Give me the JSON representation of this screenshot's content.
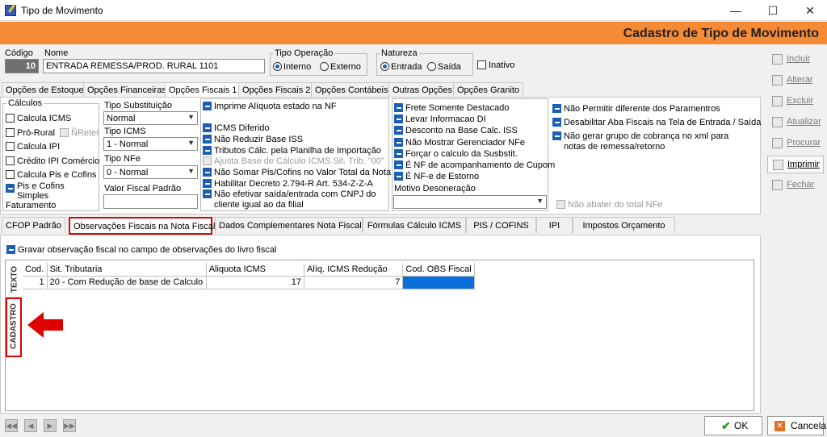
{
  "window": {
    "title": "Tipo de Movimento",
    "minimize": "—",
    "maximize": "☐",
    "close": "✕"
  },
  "header": {
    "title": "Cadastro de Tipo de Movimento"
  },
  "form": {
    "codigo_label": "Código",
    "codigo_value": "10",
    "nome_label": "Nome",
    "nome_value": "ENTRADA REMESSA/PROD. RURAL 1101",
    "tipo_operacao": {
      "label": "Tipo Operação",
      "opt1": "Interno",
      "opt2": "Externo"
    },
    "natureza": {
      "label": "Natureza",
      "opt1": "Entrada",
      "opt2": "Saída"
    },
    "inativo": "Inativo"
  },
  "top_tabs": [
    "Opções de Estoque",
    "Opções Financeiras",
    "Opções Fiscais 1",
    "Opções Fiscais 2",
    "Opções Contábeis",
    "Outras Opções",
    "Opções Granito"
  ],
  "calculos": {
    "title": "Cálculos",
    "items": [
      "Calcula ICMS",
      "Pró-Rural",
      "Calcula IPI",
      "Crédito IPI Comércio",
      "Calcula Pis e Cofins",
      "Pis e Cofins Simples Faturamento"
    ],
    "nreter": "ÑReter"
  },
  "selects": {
    "tipo_subst_label": "Tipo Substituição",
    "tipo_subst_value": "Normal",
    "tipo_icms_label": "Tipo ICMS",
    "tipo_icms_value": "1 - Normal",
    "tipo_nfe_label": "Tipo NFe",
    "tipo_nfe_value": "0 - Normal",
    "valor_fiscal_label": "Valor Fiscal Padrão"
  },
  "col2": [
    "Imprime Alíquota estado na NF",
    "ICMS Diferido",
    "Não Reduzir Base ISS",
    "Tributos Cálc. pela Planilha de Importação",
    "Ajusta Base de Cálculo ICMS Sit. Trib. \"00\"",
    "Não Somar Pis/Cofins no Valor Total da Nota",
    "Habilitar Decreto 2.794-R Art. 534-Z-Z-A",
    "Não efetivar saída/entrada com CNPJ do",
    "cliente igual ao da filial"
  ],
  "col3": [
    "Frete Somente Destacado",
    "Levar Informacao DI",
    "Desconto na Base Calc. ISS",
    "Não Mostrar Gerenciador NFe",
    "Forçar o calculo da Susbstit.",
    "É NF de acompanhamento de Cupom",
    "É NF-e de Estorno"
  ],
  "motivo_label": "Motivo Desoneração",
  "col4": [
    "Não Permitir diferente dos Paramentros",
    "Desabilitar Aba Fiscais na Tela de Entrada / Saída",
    "Não gerar grupo de cobrança no xml para",
    "notas de remessa/retorno"
  ],
  "nao_abater": "Não abater do total NFe",
  "bottom_tabs": [
    "CFOP Padrão",
    "Observações Fiscais na Nota Fiscal",
    "Dados Complementares Nota Fiscal",
    "Fórmulas Cálculo ICMS",
    "PIS / COFINS",
    "IPI",
    "Impostos Orçamento"
  ],
  "gravar_obs": "Gravar observação fiscal no campo de observações do livro fiscal",
  "vtabs": {
    "texto": "TEXTO",
    "cadastro": "CADASTRO"
  },
  "grid": {
    "headers": [
      "Cod.",
      "Sit. Tributaria",
      "Aliquota ICMS",
      "Alíq. ICMS Redução",
      "Cod. OBS Fiscal"
    ],
    "rows": [
      [
        "1",
        "20 - Com Redução de base de Calculo",
        "17",
        "7",
        ""
      ]
    ]
  },
  "side_buttons": [
    "Incluir",
    "Alterar",
    "Excluir",
    "Atualizar",
    "Procurar",
    "Imprimir",
    "Fechar"
  ],
  "footer": {
    "ok": "OK",
    "cancel": "Cancela"
  },
  "colors": {
    "header": "#f78a34",
    "highlight": "#e00000",
    "accent": "#1a5fb4"
  }
}
